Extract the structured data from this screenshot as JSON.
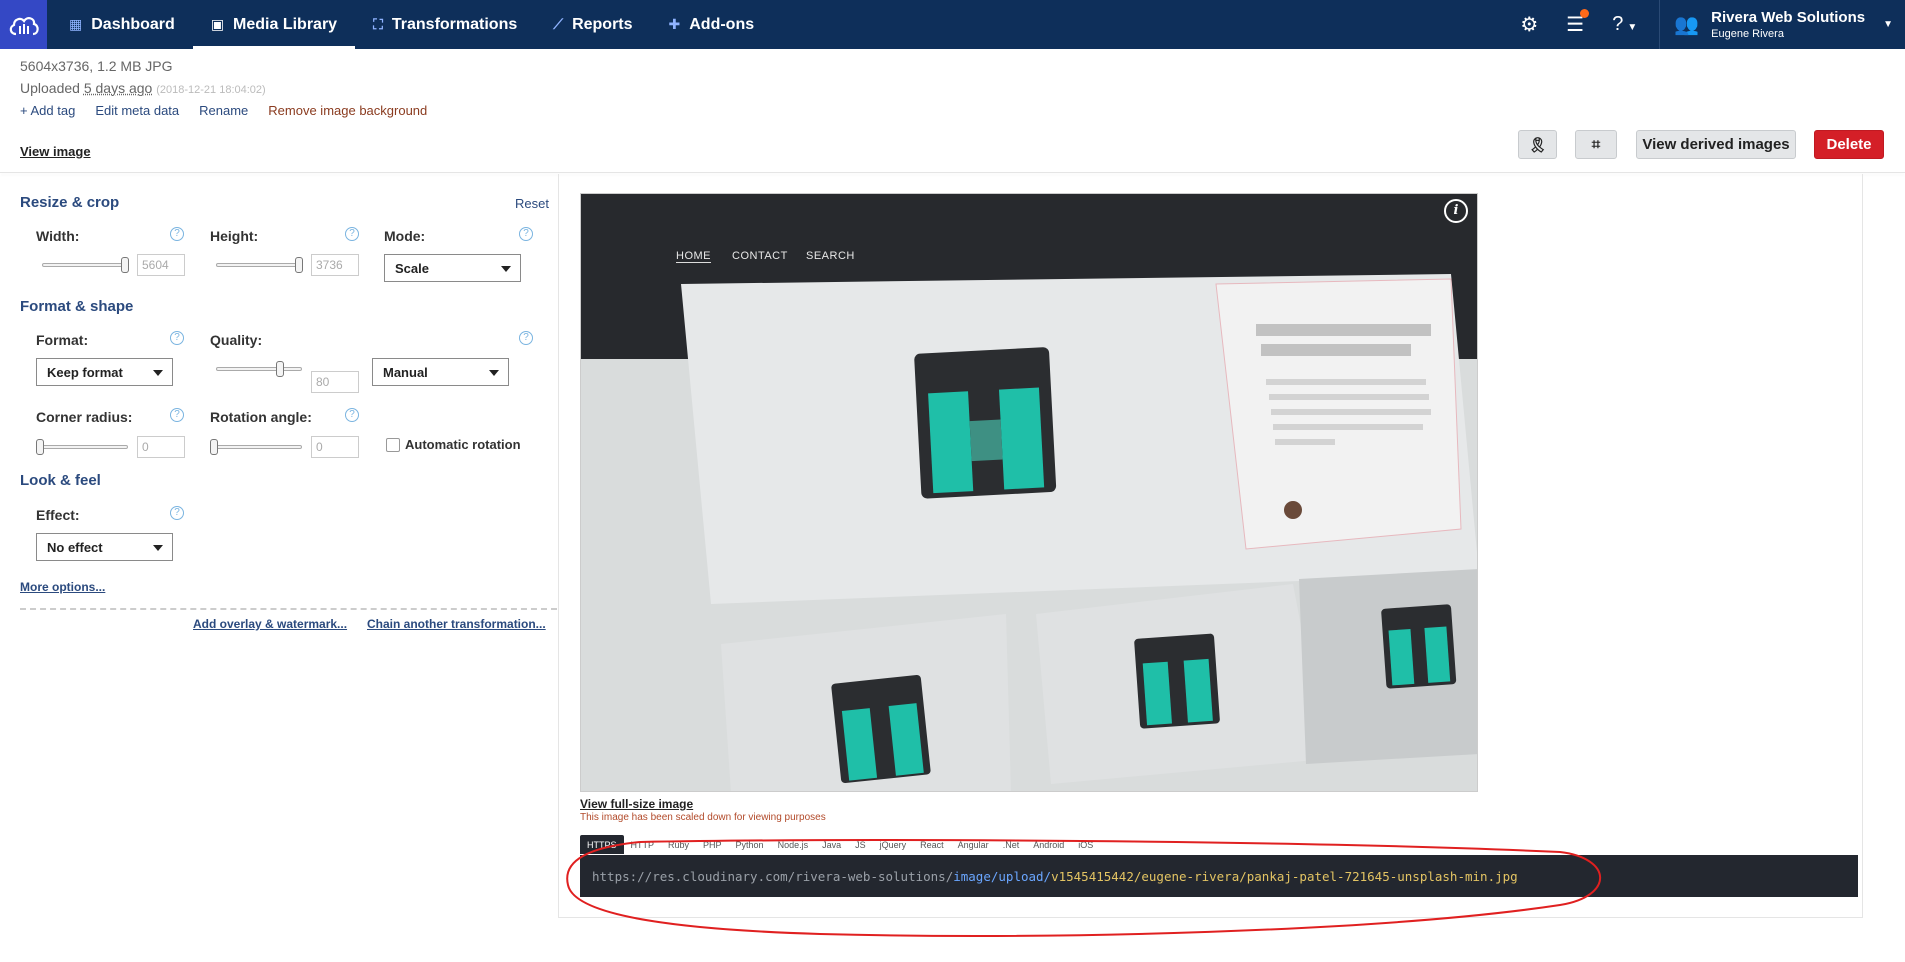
{
  "nav": {
    "items": [
      {
        "label": "Dashboard",
        "icon": "dashboard-icon"
      },
      {
        "label": "Media Library",
        "icon": "image-icon"
      },
      {
        "label": "Transformations",
        "icon": "transform-icon"
      },
      {
        "label": "Reports",
        "icon": "chart-icon"
      },
      {
        "label": "Add-ons",
        "icon": "puzzle-icon"
      }
    ],
    "active": "Media Library"
  },
  "account": {
    "org": "Rivera Web Solutions",
    "user": "Eugene Rivera"
  },
  "asset": {
    "meta": "5604x3736, 1.2 MB JPG",
    "uploaded_prefix": "Uploaded",
    "uploaded_ago": "5 days ago",
    "uploaded_ts": "(2018-12-21 18:04:02)"
  },
  "actions": {
    "add_tag": "+ Add tag",
    "edit_meta": "Edit meta data",
    "rename": "Rename",
    "remove_bg": "Remove image background"
  },
  "view_image": "View image",
  "toolbar": {
    "view_derived": "View derived images",
    "delete": "Delete"
  },
  "panel": {
    "resize_title": "Resize & crop",
    "reset": "Reset",
    "width_label": "Width:",
    "width_value": "5604",
    "height_label": "Height:",
    "height_value": "3736",
    "mode_label": "Mode:",
    "mode_value": "Scale",
    "format_title": "Format & shape",
    "format_label": "Format:",
    "format_value": "Keep format",
    "quality_label": "Quality:",
    "quality_value": "80",
    "quality_mode": "Manual",
    "corner_label": "Corner radius:",
    "corner_value": "0",
    "rotation_label": "Rotation angle:",
    "rotation_value": "0",
    "auto_rotation": "Automatic rotation",
    "look_title": "Look & feel",
    "effect_label": "Effect:",
    "effect_value": "No effect",
    "more_options": "More options...",
    "add_overlay": "Add overlay & watermark...",
    "chain": "Chain another transformation..."
  },
  "preview": {
    "nav": [
      "HOME",
      "CONTACT",
      "SEARCH"
    ],
    "view_full": "View full-size image",
    "scaled_note": "This image has been scaled down for viewing purposes"
  },
  "sdk_tabs": [
    "HTTPS",
    "HTTP",
    "Ruby",
    "PHP",
    "Python",
    "Node.js",
    "Java",
    "JS",
    "jQuery",
    "React",
    "Angular",
    ".Net",
    "Android",
    "iOS"
  ],
  "url": {
    "base": "https://res.cloudinary.com/rivera-web-solutions/",
    "type": "image/upload/",
    "rest": "v1545415442/eugene-rivera/pankaj-patel-721645-unsplash-min.jpg"
  },
  "colors": {
    "nav_bg": "#0e2f5a",
    "accent": "#3448c5",
    "delete": "#d41f27",
    "annotation": "#e02020"
  }
}
